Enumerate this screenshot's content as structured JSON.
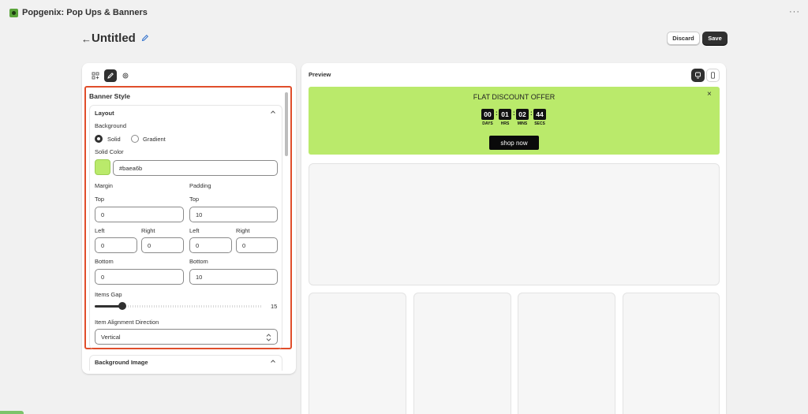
{
  "app": {
    "title": "Popgenix: Pop Ups & Banners",
    "more": "···"
  },
  "header": {
    "back": "←",
    "title": "Untitled",
    "discard_label": "Discard",
    "save_label": "Save"
  },
  "editor": {
    "tabs": [
      "elements-icon",
      "brush-icon",
      "gear-icon"
    ],
    "active_tab": 1,
    "section_title": "Banner Style",
    "layout": {
      "title": "Layout",
      "background_label": "Background",
      "background_options": [
        "Solid",
        "Gradient"
      ],
      "background_selected": "Solid",
      "solid_color_label": "Solid Color",
      "solid_color_value": "#baea6b",
      "margin_label": "Margin",
      "padding_label": "Padding",
      "top_label": "Top",
      "left_label": "Left",
      "right_label": "Right",
      "bottom_label": "Bottom",
      "margin": {
        "top": "0",
        "left": "0",
        "right": "0",
        "bottom": "0"
      },
      "padding": {
        "top": "10",
        "left": "0",
        "right": "0",
        "bottom": "10"
      },
      "items_gap_label": "Items Gap",
      "items_gap_value": "15",
      "alignment_label": "Item Alignment Direction",
      "alignment_value": "Vertical"
    },
    "background_image_title": "Background Image"
  },
  "preview": {
    "title": "Preview",
    "banner": {
      "bg_color": "#baea6b",
      "title": "FLAT DISCOUNT OFFER",
      "close": "×",
      "countdown": [
        {
          "value": "00",
          "label": "DAYS"
        },
        {
          "value": "01",
          "label": "HRS"
        },
        {
          "value": "02",
          "label": "MINS"
        },
        {
          "value": "44",
          "label": "SECS"
        }
      ],
      "separator": ":",
      "button_label": "shop now"
    }
  }
}
